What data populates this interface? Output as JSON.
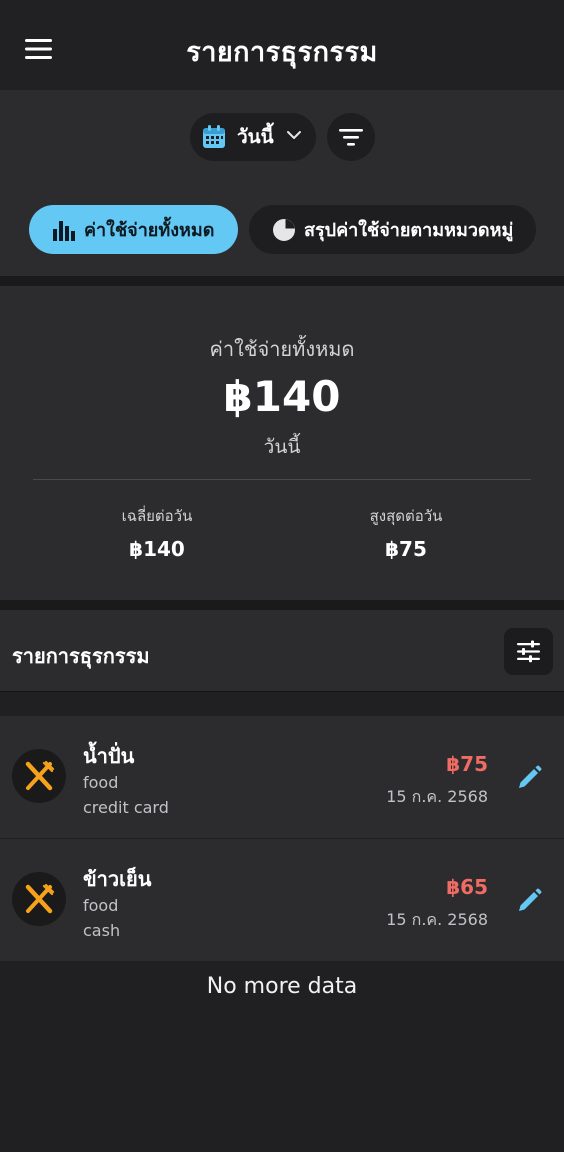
{
  "appbar": {
    "title": "รายการธุรกรรม"
  },
  "filters": {
    "date_label": "วันนี้"
  },
  "tabs": [
    {
      "label": "ค่าใช้จ่ายทั้งหมด",
      "icon": "bar-chart-icon",
      "active": true
    },
    {
      "label": "สรุปค่าใช้จ่ายตามหมวดหมู่",
      "icon": "pie-chart-icon",
      "active": false
    }
  ],
  "summary": {
    "label": "ค่าใช้จ่ายทั้งหมด",
    "total": "฿140",
    "period": "วันนี้",
    "avg_label": "เฉลี่ยต่อวัน",
    "avg_value": "฿140",
    "max_label": "สูงสุดต่อวัน",
    "max_value": "฿75"
  },
  "list": {
    "title": "รายการธุรกรรม",
    "items": [
      {
        "name": "น้ำปั่น",
        "category": "food",
        "payment": "credit card",
        "amount": "฿75",
        "date": "15 ก.ค. 2568",
        "icon": "fork-knife-icon"
      },
      {
        "name": "ข้าวเย็น",
        "category": "food",
        "payment": "cash",
        "amount": "฿65",
        "date": "15 ก.ค. 2568",
        "icon": "fork-knife-icon"
      }
    ],
    "end_text": "No more data"
  },
  "colors": {
    "accent": "#64c8f4",
    "expense": "#ef6b64",
    "icon_orange": "#f7a21b",
    "background": "#202022",
    "card": "#2c2c2e"
  }
}
